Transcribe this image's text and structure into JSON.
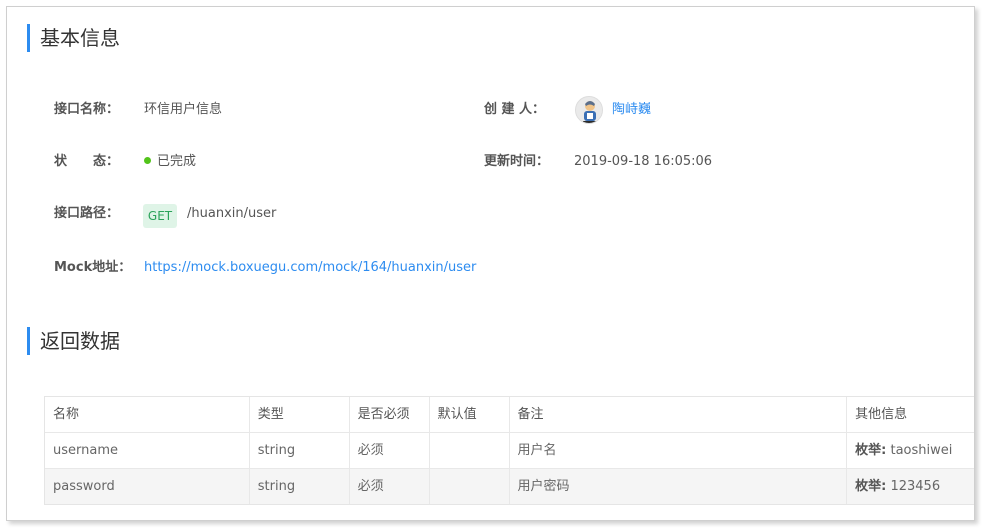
{
  "basic_info": {
    "title": "基本信息",
    "name_label": "接口名称：",
    "name_value": "环信用户信息",
    "creator_label": "创 建 人：",
    "creator_name": "陶峙巍",
    "status_label": "状　　态：",
    "status_value": "已完成",
    "status_color": "#52c41a",
    "updated_label": "更新时间：",
    "updated_value": "2019-09-18 16:05:06",
    "path_label": "接口路径：",
    "method": "GET",
    "path": "/huanxin/user",
    "mock_label": "Mock地址：",
    "mock_url": "https://mock.boxuegu.com/mock/164/huanxin/user"
  },
  "return_data": {
    "title": "返回数据",
    "columns": [
      "名称",
      "类型",
      "是否必须",
      "默认值",
      "备注",
      "其他信息"
    ],
    "rows": [
      {
        "name": "username",
        "type": "string",
        "required": "必须",
        "default": "",
        "note": "用户名",
        "other_label": "枚举:",
        "other_value": " taoshiwei"
      },
      {
        "name": "password",
        "type": "string",
        "required": "必须",
        "default": "",
        "note": "用户密码",
        "other_label": "枚举:",
        "other_value": " 123456"
      }
    ]
  },
  "colors": {
    "accent": "#2d8cf0",
    "get_badge_bg": "#dff4e7",
    "get_badge_text": "#2ba35a"
  }
}
